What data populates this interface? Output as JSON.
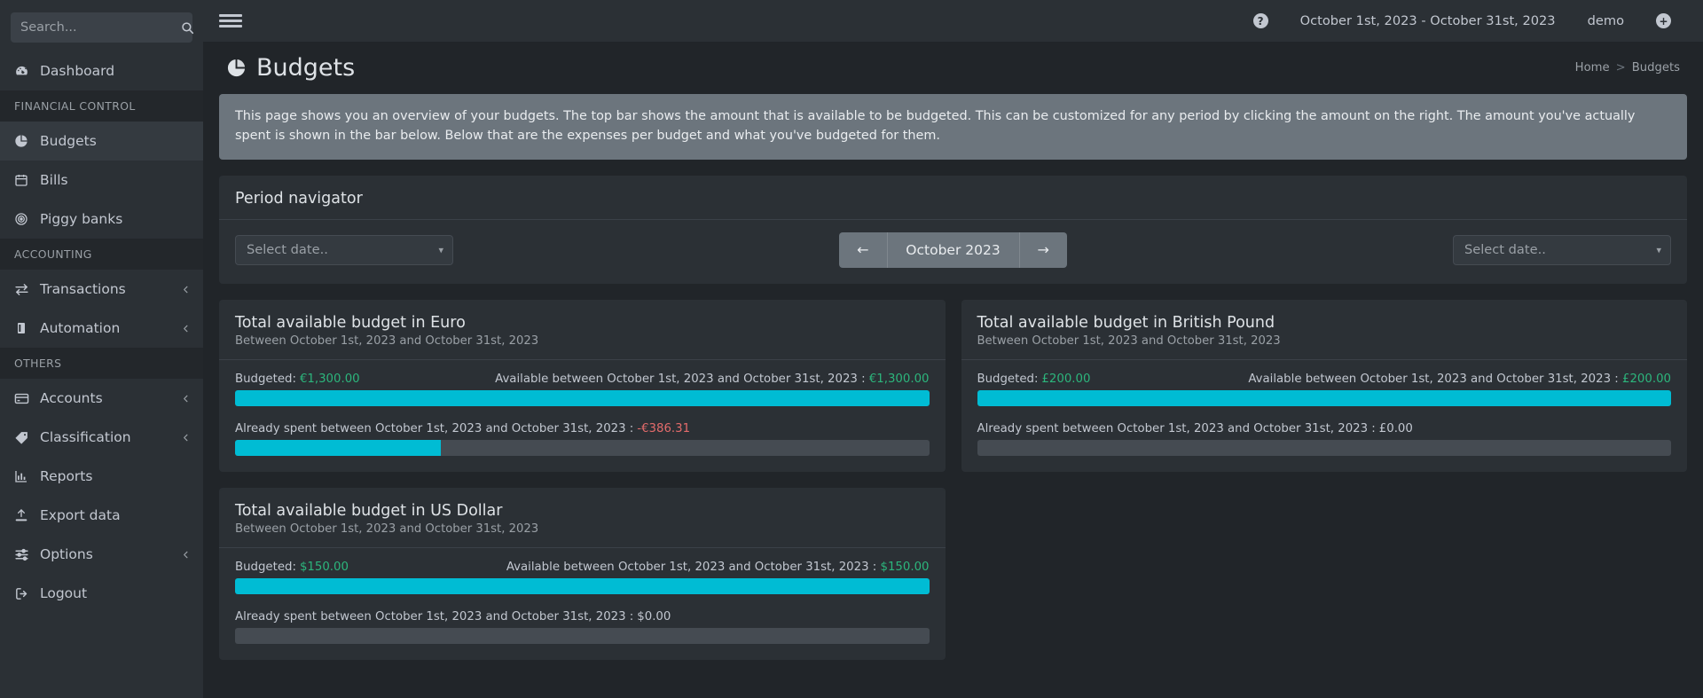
{
  "sidebar": {
    "search": {
      "placeholder": "Search...",
      "value": ""
    },
    "items": [
      {
        "label": "Dashboard",
        "icon": "dashboard-icon",
        "type": "item",
        "active": false,
        "chevron": false
      },
      {
        "label": "Financial control",
        "type": "header"
      },
      {
        "label": "Budgets",
        "icon": "pie-chart-icon",
        "type": "item",
        "active": true,
        "chevron": false
      },
      {
        "label": "Bills",
        "icon": "calendar-icon",
        "type": "item",
        "active": false,
        "chevron": false
      },
      {
        "label": "Piggy banks",
        "icon": "target-icon",
        "type": "item",
        "active": false,
        "chevron": false
      },
      {
        "label": "Accounting",
        "type": "header"
      },
      {
        "label": "Transactions",
        "icon": "exchange-icon",
        "type": "item",
        "active": false,
        "chevron": true
      },
      {
        "label": "Automation",
        "icon": "robot-icon",
        "type": "item",
        "active": false,
        "chevron": true
      },
      {
        "label": "Others",
        "type": "header"
      },
      {
        "label": "Accounts",
        "icon": "credit-card-icon",
        "type": "item",
        "active": false,
        "chevron": true
      },
      {
        "label": "Classification",
        "icon": "tag-icon",
        "type": "item",
        "active": false,
        "chevron": true
      },
      {
        "label": "Reports",
        "icon": "bar-chart-icon",
        "type": "item",
        "active": false,
        "chevron": false
      },
      {
        "label": "Export data",
        "icon": "upload-icon",
        "type": "item",
        "active": false,
        "chevron": false
      },
      {
        "label": "Options",
        "icon": "sliders-icon",
        "type": "item",
        "active": false,
        "chevron": true
      },
      {
        "label": "Logout",
        "icon": "sign-out-icon",
        "type": "item",
        "active": false,
        "chevron": false
      }
    ]
  },
  "topnav": {
    "menu_icon": "hamburger-icon",
    "help_icon": "question-circle-icon",
    "date_range": "October 1st, 2023 - October 31st, 2023",
    "user": "demo",
    "settings_icon": "plus-circle-icon"
  },
  "header": {
    "title": "Budgets",
    "title_icon": "pie-chart-icon",
    "breadcrumb": {
      "home": "Home",
      "separator": ">",
      "current": "Budgets"
    }
  },
  "info_box": {
    "text": "This page shows you an overview of your budgets. The top bar shows the amount that is available to be budgeted. This can be customized for any period by clicking the amount on the right. The amount you've actually spent is shown in the bar below. Below that are the expenses per budget and what you've budgeted for them."
  },
  "period_navigator": {
    "title": "Period navigator",
    "left_select": {
      "placeholder": "Select date..",
      "value": "Select date.."
    },
    "right_select": {
      "placeholder": "Select date..",
      "value": "Select date.."
    },
    "prev_label": "←",
    "current_label": "October 2023",
    "next_label": "→"
  },
  "budget_cards": [
    {
      "title": "Total available budget in Euro",
      "subtitle": "Between October 1st, 2023 and October 31st, 2023",
      "budgeted_label": "Budgeted:",
      "budgeted_amount": "€1,300.00",
      "budgeted_color": "#2cb57c",
      "available_label": "Available between October 1st, 2023 and October 31st, 2023 :",
      "available_amount": "€1,300.00",
      "available_color": "#2cb57c",
      "available_pct": 100,
      "spent_label": "Already spent between October 1st, 2023 and October 31st, 2023 :",
      "spent_amount": "-€386.31",
      "spent_color": "#e36b6b",
      "spent_pct": 29.7,
      "bar_color": "#00bcd4"
    },
    {
      "title": "Total available budget in British Pound",
      "subtitle": "Between October 1st, 2023 and October 31st, 2023",
      "budgeted_label": "Budgeted:",
      "budgeted_amount": "£200.00",
      "budgeted_color": "#2cb57c",
      "available_label": "Available between October 1st, 2023 and October 31st, 2023 :",
      "available_amount": "£200.00",
      "available_color": "#2cb57c",
      "available_pct": 100,
      "spent_label": "Already spent between October 1st, 2023 and October 31st, 2023 :",
      "spent_amount": "£0.00",
      "spent_color": "#c2c7d0",
      "spent_pct": 0,
      "bar_color": "#00bcd4"
    },
    {
      "title": "Total available budget in US Dollar",
      "subtitle": "Between October 1st, 2023 and October 31st, 2023",
      "budgeted_label": "Budgeted:",
      "budgeted_amount": "$150.00",
      "budgeted_color": "#2cb57c",
      "available_label": "Available between October 1st, 2023 and October 31st, 2023 :",
      "available_amount": "$150.00",
      "available_color": "#2cb57c",
      "available_pct": 100,
      "spent_label": "Already spent between October 1st, 2023 and October 31st, 2023 :",
      "spent_amount": "$0.00",
      "spent_color": "#c2c7d0",
      "spent_pct": 0,
      "bar_color": "#00bcd4"
    }
  ]
}
